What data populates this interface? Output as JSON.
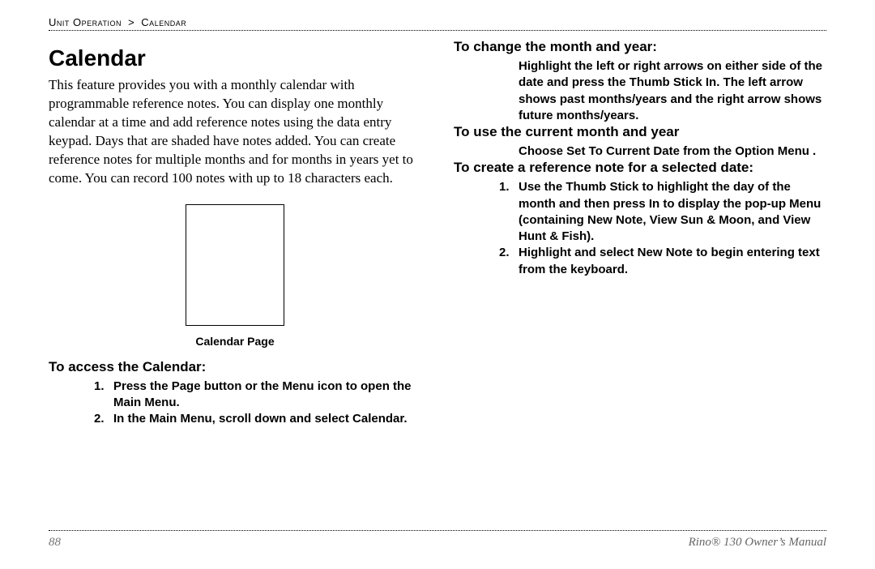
{
  "header": {
    "breadcrumb_section": "Unit Operation",
    "breadcrumb_sep": ">",
    "breadcrumb_page": "Calendar"
  },
  "left": {
    "title": "Calendar",
    "intro": "This feature provides you with a monthly calendar with programmable reference notes. You can display one monthly calendar at a time and add reference notes using the data entry keypad. Days that are shaded have notes added. You can create reference notes for multiple months and for months in years yet to come. You can record 100 notes with up to 18 characters each.",
    "figure_caption": "Calendar Page",
    "access_head": "To access the Calendar:",
    "access_steps": [
      "Press the Page button or the Menu icon       to open the Main Menu.",
      "In the Main Menu, scroll down and select Calendar."
    ]
  },
  "right": {
    "change_head": "To change the month and year:",
    "change_body": "Highlight the left or right arrows on either side of the date and press the Thumb Stick In. The left arrow shows past months/years and the right arrow shows future months/years.",
    "current_head": "To use the current month and year",
    "current_body": "Choose Set To Current Date from the Option Menu    .",
    "create_head": "To create a reference note for a selected date:",
    "create_steps": [
      "Use the Thumb Stick to highlight the day of the month and then press In to display the pop-up Menu (containing New Note, View Sun & Moon, and View Hunt & Fish).",
      "Highlight and select New Note to begin entering text from the keyboard."
    ]
  },
  "footer": {
    "page_number": "88",
    "book_title": "Rino® 130 Owner’s Manual"
  }
}
